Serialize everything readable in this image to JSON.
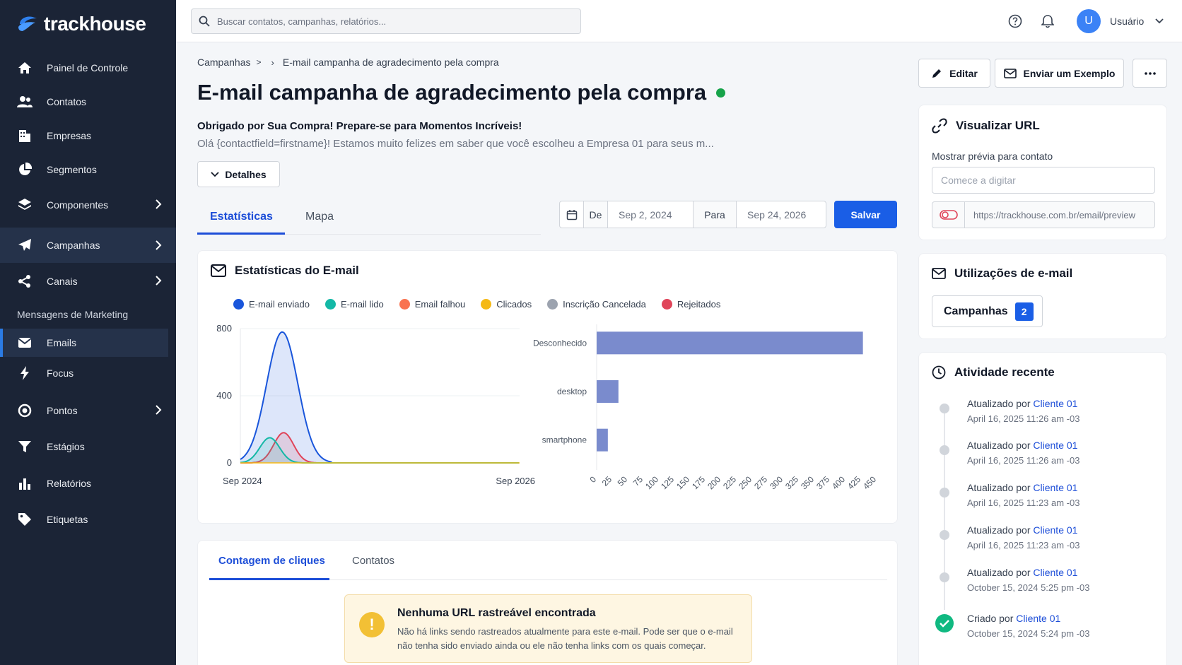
{
  "app": {
    "name": "trackhouse"
  },
  "sidebar": {
    "items": [
      {
        "label": "Painel de Controle",
        "icon": "home-icon"
      },
      {
        "label": "Contatos",
        "icon": "users-icon"
      },
      {
        "label": "Empresas",
        "icon": "building-icon"
      },
      {
        "label": "Segmentos",
        "icon": "pie-icon"
      },
      {
        "label": "Componentes",
        "icon": "layers-icon",
        "expandable": true
      },
      {
        "label": "Campanhas",
        "icon": "paper-plane-icon",
        "expandable": true,
        "active": true
      },
      {
        "label": "Canais",
        "icon": "share-icon",
        "expandable": true
      }
    ],
    "section_label": "Mensagens de Marketing",
    "items2": [
      {
        "label": "Emails",
        "icon": "envelope-icon",
        "selected": true
      },
      {
        "label": "Focus",
        "icon": "bolt-icon"
      },
      {
        "label": "Pontos",
        "icon": "target-icon",
        "expandable": true
      },
      {
        "label": "Estágios",
        "icon": "filter-icon"
      },
      {
        "label": "Relatórios",
        "icon": "bar-chart-icon"
      },
      {
        "label": "Etiquetas",
        "icon": "tag-icon"
      }
    ]
  },
  "topbar": {
    "search_placeholder": "Buscar contatos, campanhas, relatórios...",
    "avatar_initial": "U",
    "username": "Usuário"
  },
  "main": {
    "breadcrumb_parent": "Campanhas",
    "breadcrumb_current": "E-mail campanha de agradecimento pela compra",
    "title": "E-mail campanha de agradecimento pela compra",
    "status_color": "#16a34a",
    "subject": "Obrigado por Sua Compra! Prepare-se para Momentos Incríveis!",
    "preview": "Olá {contactfield=firstname}! Estamos muito felizes em saber que você escolheu a Empresa 01 para seus m...",
    "details_label": "Detalhes",
    "tabs": [
      "Estatísticas",
      "Mapa"
    ],
    "date_from_label": "De",
    "date_from": "Sep 2, 2024",
    "date_to_label": "Para",
    "date_to": "Sep 24, 2026",
    "save_label": "Salvar"
  },
  "stats": {
    "title": "Estatísticas do E-mail",
    "legend": [
      {
        "name": "E-mail enviado",
        "color": "#1a56db"
      },
      {
        "name": "E-mail lido",
        "color": "#14b8a6"
      },
      {
        "name": "Email falhou",
        "color": "#f97350"
      },
      {
        "name": "Clicados",
        "color": "#f5b915"
      },
      {
        "name": "Inscrição Cancelada",
        "color": "#9ca3af"
      },
      {
        "name": "Rejeitados",
        "color": "#e0455a"
      }
    ]
  },
  "chart_data": [
    {
      "type": "area",
      "x_tick_labels": [
        "Sep 2024",
        "Sep 2026"
      ],
      "y_ticks": [
        0,
        400,
        800
      ],
      "ylim": [
        0,
        800
      ],
      "series": [
        {
          "name": "E-mail enviado",
          "peak": 780,
          "peak_pos": 0.15
        },
        {
          "name": "E-mail lido",
          "peak": 150,
          "peak_pos": 0.105
        },
        {
          "name": "Rejeitados",
          "peak": 180,
          "peak_pos": 0.155
        }
      ]
    },
    {
      "type": "bar",
      "orientation": "horizontal",
      "categories": [
        "Desconhecido",
        "desktop",
        "smartphone"
      ],
      "values": [
        428,
        35,
        18
      ],
      "xlim": [
        0,
        450
      ],
      "x_ticks": [
        0,
        25,
        50,
        75,
        100,
        125,
        150,
        175,
        200,
        225,
        250,
        275,
        300,
        325,
        350,
        375,
        400,
        425,
        450
      ],
      "color": "#7a8bcd"
    }
  ],
  "clicks": {
    "tabs": [
      "Contagem de cliques",
      "Contatos"
    ],
    "warning_title": "Nenhuma URL rastreável encontrada",
    "warning_text": "Não há links sendo rastreados atualmente para este e-mail. Pode ser que o e-mail não tenha sido enviado ainda ou ele não tenha links com os quais começar."
  },
  "right": {
    "edit_label": "Editar",
    "send_example_label": "Enviar um Exemplo",
    "url_title": "Visualizar URL",
    "preview_label": "Mostrar prévia para contato",
    "preview_placeholder": "Comece a digitar",
    "url_value": "https://trackhouse.com.br/email/preview",
    "usage_title": "Utilizações de e-mail",
    "usage_button": "Campanhas",
    "usage_count": "2",
    "activity_title": "Atividade recente",
    "activity": [
      {
        "action": "Atualizado por",
        "user": "Cliente 01",
        "date": "April 16, 2025 11:26 am -03"
      },
      {
        "action": "Atualizado por",
        "user": "Cliente 01",
        "date": "April 16, 2025 11:26 am -03"
      },
      {
        "action": "Atualizado por",
        "user": "Cliente 01",
        "date": "April 16, 2025 11:23 am -03"
      },
      {
        "action": "Atualizado por",
        "user": "Cliente 01",
        "date": "April 16, 2025 11:23 am -03"
      },
      {
        "action": "Atualizado por",
        "user": "Cliente 01",
        "date": "October 15, 2024 5:25 pm -03"
      },
      {
        "action": "Criado por",
        "user": "Cliente 01",
        "date": "October 15, 2024 5:24 pm -03"
      }
    ]
  }
}
